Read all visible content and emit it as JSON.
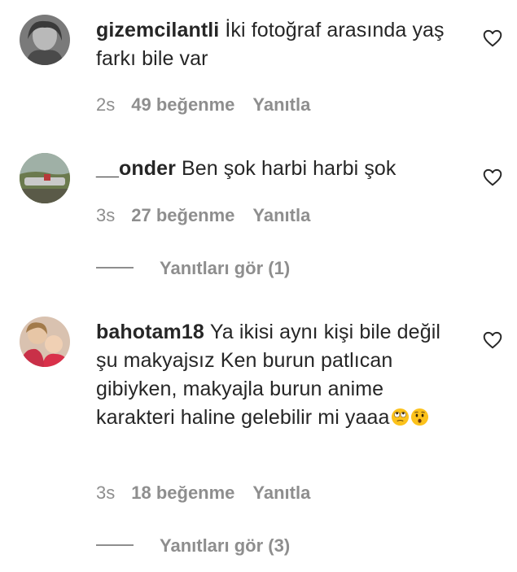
{
  "comments": [
    {
      "username": "gizemcilantli",
      "text": "İki fotoğraf arasında yaş farkı bile var",
      "time": "2s",
      "likes": "49 beğenme",
      "reply": "Yanıtla",
      "avatar_icon": "user-avatar-photo"
    },
    {
      "username": "__onder",
      "text": "Ben şok harbi harbi şok",
      "time": "3s",
      "likes": "27 beğenme",
      "reply": "Yanıtla",
      "view_replies": "Yanıtları gör (1)",
      "avatar_icon": "user-avatar-photo"
    },
    {
      "username": "bahotam18",
      "text": "Ya ikisi aynı kişi bile değil şu makyajsız Ken burun patlıcan gibiyken, makyajla burun anime karakteri haline gelebilir mi yaaa",
      "emojis": [
        "face-with-rolling-eyes",
        "hushed-face"
      ],
      "time": "3s",
      "likes": "18 beğenme",
      "reply": "Yanıtla",
      "view_replies": "Yanıtları gör (3)",
      "avatar_icon": "user-avatar-photo"
    }
  ],
  "icons": {
    "like": "heart-outline-icon"
  },
  "colors": {
    "text": "#262626",
    "secondary": "#8e8e8e",
    "background": "#ffffff"
  }
}
